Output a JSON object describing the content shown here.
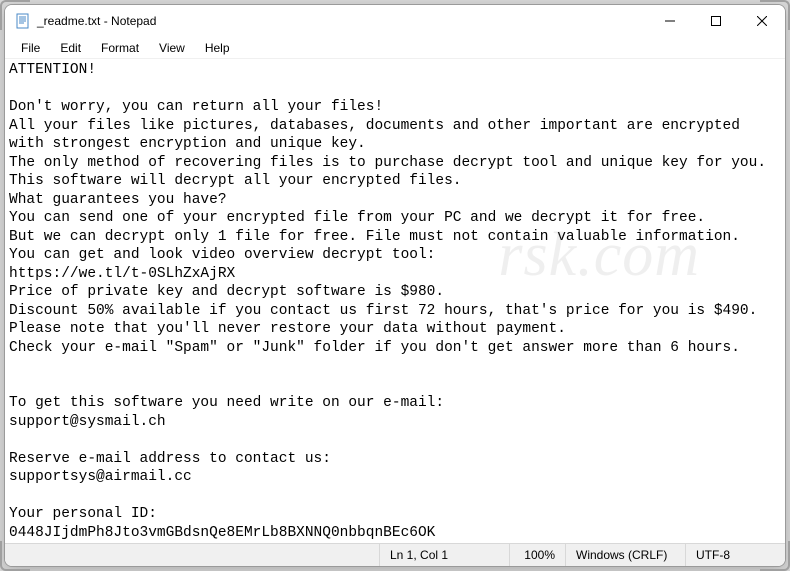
{
  "titlebar": {
    "title": "_readme.txt - Notepad"
  },
  "menubar": {
    "file": "File",
    "edit": "Edit",
    "format": "Format",
    "view": "View",
    "help": "Help"
  },
  "document": {
    "content": "ATTENTION!\n\nDon't worry, you can return all your files!\nAll your files like pictures, databases, documents and other important are encrypted with strongest encryption and unique key.\nThe only method of recovering files is to purchase decrypt tool and unique key for you.\nThis software will decrypt all your encrypted files.\nWhat guarantees you have?\nYou can send one of your encrypted file from your PC and we decrypt it for free.\nBut we can decrypt only 1 file for free. File must not contain valuable information.\nYou can get and look video overview decrypt tool:\nhttps://we.tl/t-0SLhZxAjRX\nPrice of private key and decrypt software is $980.\nDiscount 50% available if you contact us first 72 hours, that's price for you is $490.\nPlease note that you'll never restore your data without payment.\nCheck your e-mail \"Spam\" or \"Junk\" folder if you don't get answer more than 6 hours.\n\n\nTo get this software you need write on our e-mail:\nsupport@sysmail.ch\n\nReserve e-mail address to contact us:\nsupportsys@airmail.cc\n\nYour personal ID:\n0448JIjdmPh8Jto3vmGBdsnQe8EMrLb8BXNNQ0nbbqnBEc6OK"
  },
  "statusbar": {
    "lncol": "Ln 1, Col 1",
    "zoom": "100%",
    "eol": "Windows (CRLF)",
    "encoding": "UTF-8"
  },
  "watermark": "rsk.com"
}
